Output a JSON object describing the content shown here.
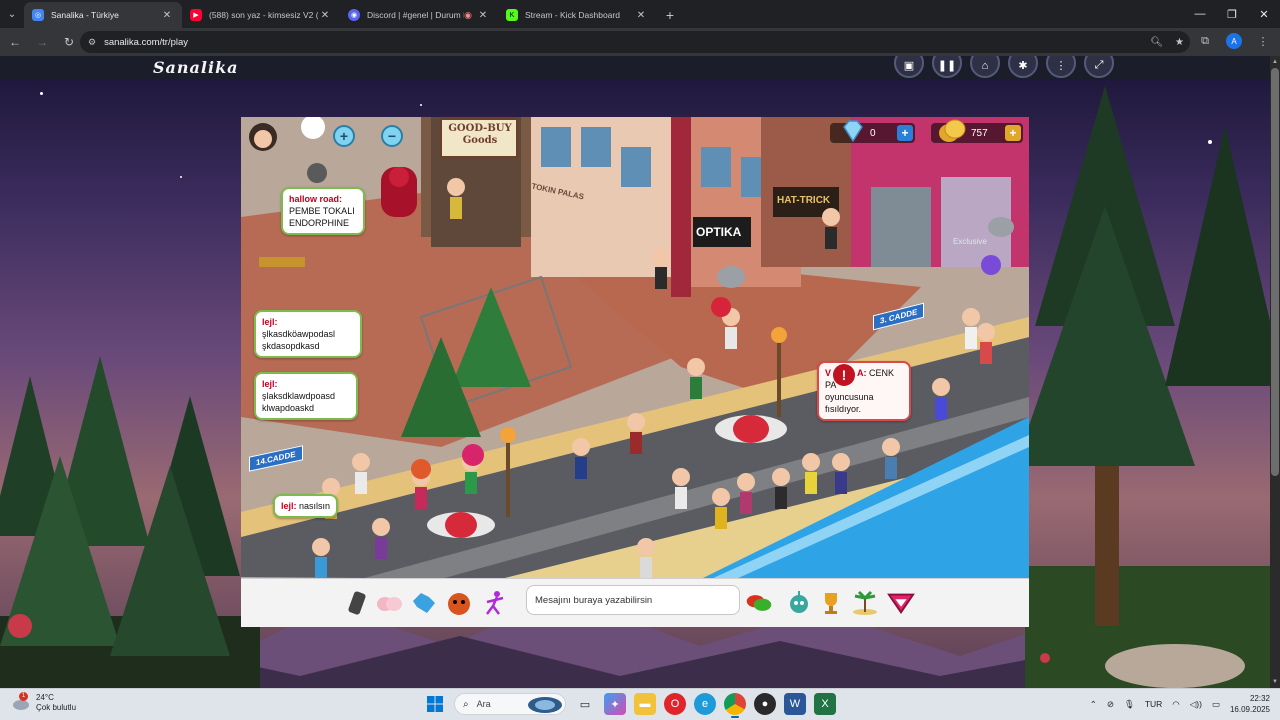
{
  "browser": {
    "tabs": [
      {
        "title": "Sanalika - Türkiye",
        "active": true,
        "favicon_color": "#4285f4"
      },
      {
        "title": "(588) son yaz - kimsesiz V2 (slo",
        "active": false,
        "favicon_color": "#ff0033"
      },
      {
        "title": "Discord | #genel | Durum B",
        "active": false,
        "favicon_color": "#5865f2"
      },
      {
        "title": "Stream - Kick Dashboard",
        "active": false,
        "favicon_color": "#53fc18"
      }
    ],
    "url": "sanalika.com/tr/play"
  },
  "site": {
    "logo_text": "Sanalika"
  },
  "game": {
    "hud": {
      "diamonds": "0",
      "coins": "757"
    },
    "bubbles": {
      "b1": {
        "who": "hallow road:",
        "text": "PEMBE TOKALI ENDORPHINE"
      },
      "b2": {
        "who": "lejl:",
        "text": "şlkasdköawpodasl şkdasopdkasd"
      },
      "b3": {
        "who": "lejl:",
        "text": "şlaksdklawdpoasd klwapdoaskd"
      },
      "b4": {
        "who": "lejl:",
        "text": "nasılsın"
      },
      "whisper": {
        "prefix": "V",
        "who": "A:",
        "name": "CENK",
        "text2": "PA",
        "text3": "oyuncusuna",
        "text4": "fısıldıyor."
      }
    },
    "signs": {
      "left": "14.CADDE",
      "right": "3. CADDE"
    },
    "shops": {
      "goodbuy": "GOOD-BUY Goods",
      "optika": "OPTIKA",
      "hattrick": "HAT-TRICK",
      "palas": "TOKIN PALAS"
    },
    "exclusive_label": "Exclusive"
  },
  "chat": {
    "placeholder": "Mesajını buraya yazabilirsin"
  },
  "taskbar": {
    "weather_temp": "24°C",
    "weather_desc": "Çok bulutlu",
    "weather_badge": "1",
    "search": "Ara",
    "lang": "TUR",
    "time": "22:32",
    "date": "16.09.2025"
  }
}
